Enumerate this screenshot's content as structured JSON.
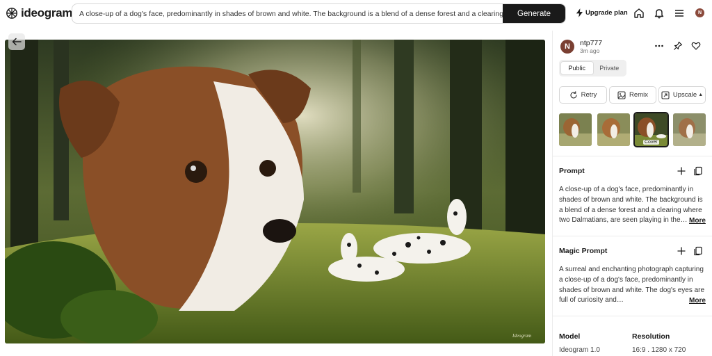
{
  "header": {
    "logo_text": "ideogram",
    "search_value": "A close-up of a dog's face, predominantly in shades of brown and white. The background is a blend of a dense forest and a clearing where two Dalmatians are seen playing",
    "generate_label": "Generate",
    "upgrade_label": "Upgrade plan",
    "avatar_initial": "N",
    "icons": [
      "bolt-icon",
      "home-icon",
      "bell-icon",
      "menu-icon"
    ]
  },
  "image": {
    "signature": "Ideogram"
  },
  "panel": {
    "user": {
      "initial": "N",
      "name": "ntp777",
      "time": "3m ago"
    },
    "visibility": {
      "options": [
        "Public",
        "Private"
      ],
      "selected": "Public"
    },
    "actions": [
      {
        "label": "Retry",
        "icon": "retry-icon"
      },
      {
        "label": "Remix",
        "icon": "remix-icon"
      },
      {
        "label": "Upscale",
        "icon": "upscale-icon"
      }
    ],
    "thumbnails": {
      "cover_label": "Cover",
      "selected_index": 2
    },
    "prompt": {
      "title": "Prompt",
      "text": "A close-up of a dog's face, predominantly in shades of brown and white. The background is a blend of a dense forest and a clearing where two Dalmatians, are seen playing in the…",
      "more": "More"
    },
    "magic_prompt": {
      "title": "Magic Prompt",
      "text": "A surreal and enchanting photograph capturing a close-up of a dog's face, predominantly in shades of brown and white. The dog's eyes are full of curiosity and…",
      "more": "More"
    },
    "meta": {
      "model_title": "Model",
      "model_value": "Ideogram 1.0",
      "resolution_title": "Resolution",
      "resolution_value": "16:9 . 1280 x 720"
    }
  },
  "colors": {
    "accent": "#1a1a1a",
    "avatar": "#7a3f32"
  }
}
